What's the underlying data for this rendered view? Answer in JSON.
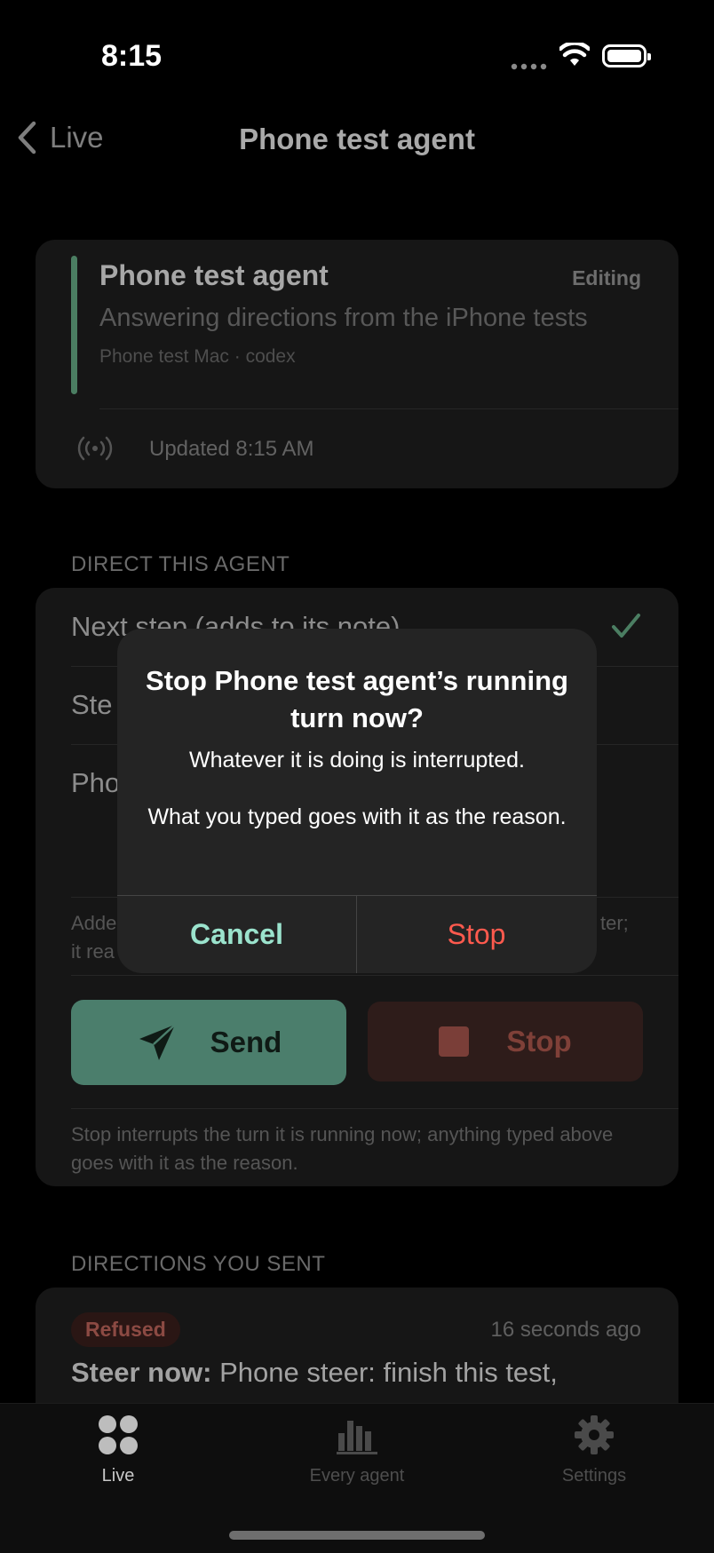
{
  "status_bar": {
    "time": "8:15"
  },
  "nav": {
    "back_label": "Live",
    "title": "Phone test agent"
  },
  "agent_card": {
    "name": "Phone test agent",
    "state": "Editing",
    "subtitle": "Answering directions from the iPhone tests",
    "meta": "Phone test Mac · codex",
    "updated": "Updated 8:15 AM"
  },
  "direct": {
    "header": "DIRECT THIS AGENT",
    "option_next": "Next step (adds to its note)",
    "option_steer_partial": "Ste",
    "input_partial": "Pho",
    "hint_left_1": "Adde",
    "hint_left_2": "it rea",
    "hint_right_1": "ter;",
    "send_label": "Send",
    "stop_label": "Stop",
    "stop_hint": "Stop interrupts the turn it is running now; anything typed above goes with it as the reason."
  },
  "history": {
    "header": "DIRECTIONS YOU SENT",
    "items": [
      {
        "status": "Refused",
        "ago": "16 seconds ago",
        "kind": "Steer now:",
        "text": "Phone steer: finish this test,"
      }
    ]
  },
  "tabs": [
    {
      "label": "Live",
      "icon": "grid-dots-icon"
    },
    {
      "label": "Every agent",
      "icon": "bar-chart-icon"
    },
    {
      "label": "Settings",
      "icon": "gear-icon"
    }
  ],
  "alert": {
    "title": "Stop Phone test agent’s running turn now?",
    "message": "Whatever it is doing is interrupted.\n\nWhat you typed goes with it as the reason.",
    "cancel_label": "Cancel",
    "stop_label": "Stop"
  },
  "colors": {
    "accent_green": "#4b7e6c",
    "destructive": "#ff5a4e",
    "cancel_tint": "#9be3cd"
  }
}
